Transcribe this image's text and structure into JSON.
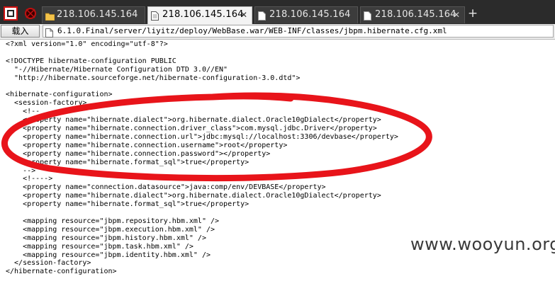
{
  "tabs": [
    {
      "title": "218.106.145.164",
      "active": false,
      "icon": "folder-icon"
    },
    {
      "title": "218.106.145.164",
      "active": true,
      "icon": "document-icon"
    },
    {
      "title": "218.106.145.164",
      "active": false,
      "icon": "document-icon"
    },
    {
      "title": "218.106.145.164",
      "active": false,
      "icon": "document-icon"
    }
  ],
  "tab_close_glyph": "✕",
  "new_tab_glyph": "+",
  "toolbar": {
    "load_label": "载入"
  },
  "address": {
    "url": "6.1.0.Final/server/liyitz/deploy/WebBase.war/WEB-INF/classes/jbpm.hibernate.cfg.xml"
  },
  "document": {
    "lines": [
      "<?xml version=\"1.0\" encoding=\"utf-8\"?>",
      "",
      "<!DOCTYPE hibernate-configuration PUBLIC",
      "  \"-//Hibernate/Hibernate Configuration DTD 3.0//EN\"",
      "  \"http://hibernate.sourceforge.net/hibernate-configuration-3.0.dtd\">",
      "",
      "<hibernate-configuration>",
      "  <session-factory>",
      "    <!--",
      "    <property name=\"hibernate.dialect\">org.hibernate.dialect.Oracle10gDialect</property>",
      "    <property name=\"hibernate.connection.driver_class\">com.mysql.jdbc.Driver</property>",
      "    <property name=\"hibernate.connection.url\">jdbc:mysql://localhost:3306/devbase</property>",
      "    <property name=\"hibernate.connection.username\">root</property>",
      "    <property name=\"hibernate.connection.password\"></property>",
      "    <property name=\"hibernate.format_sql\">true</property>",
      "    -->",
      "    <!---->",
      "    <property name=\"connection.datasource\">java:comp/env/DEVBASE</property>",
      "    <property name=\"hibernate.dialect\">org.hibernate.dialect.Oracle10gDialect</property>",
      "    <property name=\"hibernate.format_sql\">true</property>",
      "",
      "    <mapping resource=\"jbpm.repository.hbm.xml\" />",
      "    <mapping resource=\"jbpm.execution.hbm.xml\" />",
      "    <mapping resource=\"jbpm.history.hbm.xml\" />",
      "    <mapping resource=\"jbpm.task.hbm.xml\" />",
      "    <mapping resource=\"jbpm.identity.hbm.xml\" />",
      "  </session-factory>",
      "</hibernate-configuration>"
    ]
  },
  "watermark": "www.wooyun.org",
  "colors": {
    "tabbar_bg": "#2b2b2b",
    "annotation_red": "#e8141a",
    "text": "#000000"
  }
}
